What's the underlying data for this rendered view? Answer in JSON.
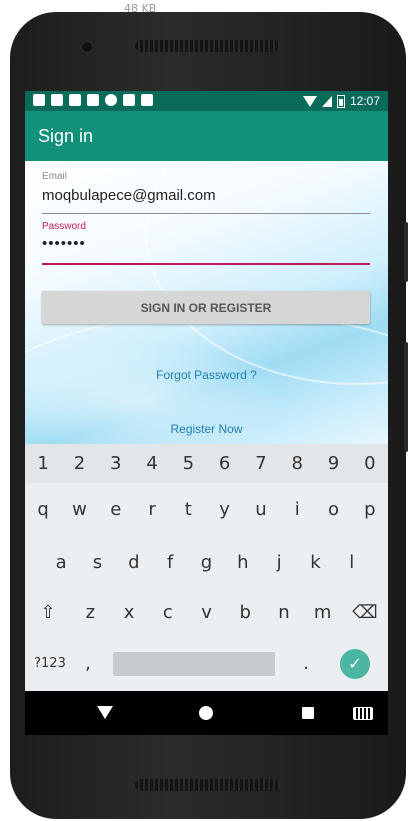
{
  "file_size_label": "48 KB",
  "status_bar": {
    "time": "12:07",
    "icons": [
      "shield-icon",
      "mail-icon",
      "image-icon",
      "mail-icon",
      "circle-icon",
      "sd-card-icon",
      "flag-icon"
    ]
  },
  "app_bar": {
    "title": "Sign in"
  },
  "form": {
    "email_label": "Email",
    "email_value": "moqbulapece@gmail.com",
    "password_label": "Password",
    "password_value": "•••••••",
    "signin_button": "SIGN IN OR REGISTER",
    "forgot_link": "Forgot Password ?",
    "register_link": "Register Now"
  },
  "keyboard": {
    "numbers": [
      "1",
      "2",
      "3",
      "4",
      "5",
      "6",
      "7",
      "8",
      "9",
      "0"
    ],
    "row1": [
      "q",
      "w",
      "e",
      "r",
      "t",
      "y",
      "u",
      "i",
      "o",
      "p"
    ],
    "row2": [
      "a",
      "s",
      "d",
      "f",
      "g",
      "h",
      "j",
      "k",
      "l"
    ],
    "row3": [
      "z",
      "x",
      "c",
      "v",
      "b",
      "n",
      "m"
    ],
    "symbols_key": "?123",
    "comma_key": ",",
    "period_key": ".",
    "shift_icon": "⇧",
    "backspace_icon": "⌫",
    "enter_icon": "✓"
  },
  "colors": {
    "status_bar": "#0b6b5b",
    "app_bar": "#12917a",
    "accent": "#c2185b",
    "link": "#1e7fb0"
  }
}
